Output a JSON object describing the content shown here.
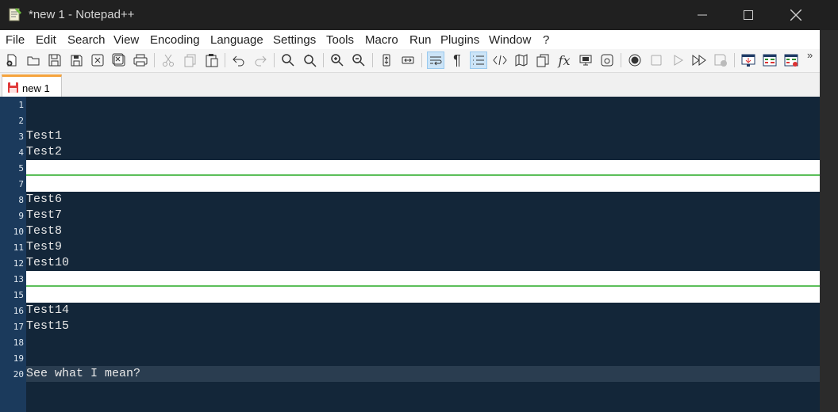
{
  "window": {
    "title": "*new 1 - Notepad++"
  },
  "menu": [
    "File",
    "Edit",
    "Search",
    "View",
    "Encoding",
    "Language",
    "Settings",
    "Tools",
    "Macro",
    "Run",
    "Plugins",
    "Window",
    "?"
  ],
  "tab": {
    "label": "new 1"
  },
  "editor": {
    "lines": [
      {
        "num": "1",
        "text": ""
      },
      {
        "num": "2",
        "text": ""
      },
      {
        "num": "3",
        "text": "Test1"
      },
      {
        "num": "4",
        "text": "Test2"
      },
      {
        "num": "5",
        "text": ""
      },
      {
        "num": "7",
        "text": ""
      },
      {
        "num": "8",
        "text": "Test6"
      },
      {
        "num": "9",
        "text": "Test7"
      },
      {
        "num": "10",
        "text": "Test8"
      },
      {
        "num": "11",
        "text": "Test9"
      },
      {
        "num": "12",
        "text": "Test10"
      },
      {
        "num": "13",
        "text": ""
      },
      {
        "num": "15",
        "text": ""
      },
      {
        "num": "16",
        "text": "Test14"
      },
      {
        "num": "17",
        "text": "Test15"
      },
      {
        "num": "18",
        "text": ""
      },
      {
        "num": "19",
        "text": ""
      },
      {
        "num": "20",
        "text": "See what I mean?"
      }
    ]
  },
  "toolbar_icons": [
    "new-file",
    "open-file",
    "save",
    "save-all",
    "close",
    "close-all",
    "print",
    "cut",
    "copy",
    "paste",
    "undo",
    "redo",
    "find",
    "replace",
    "zoom-in",
    "zoom-out",
    "sync-vertical",
    "sync-horizontal",
    "word-wrap",
    "show-all-chars",
    "indent-guide",
    "udl",
    "doc-map",
    "doc-list",
    "function-list",
    "folder-as-workspace",
    "monitoring",
    "record-macro",
    "stop-macro",
    "play-macro",
    "run-macro-multiple",
    "save-macro",
    "panel-1",
    "panel-2",
    "panel-3"
  ],
  "colors": {
    "editor_bg": "#132639",
    "gutter_bg": "#1b3a5c",
    "fold_line": "#5cbf5a",
    "tab_accent": "#f6a33c"
  }
}
